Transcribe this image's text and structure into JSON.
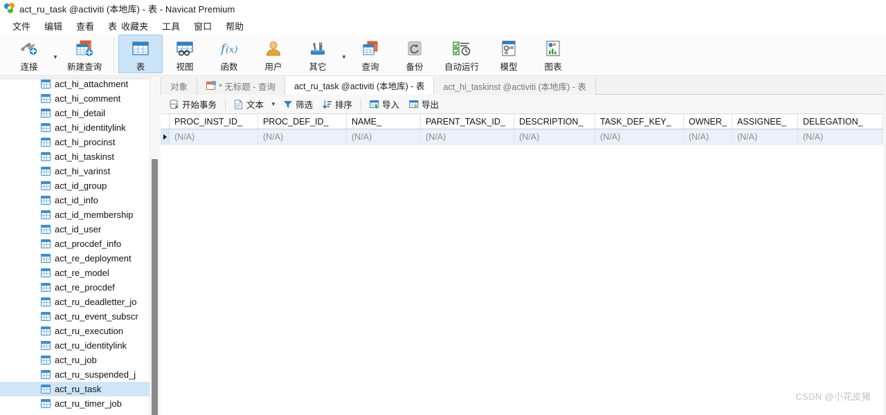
{
  "window": {
    "title": "act_ru_task @activiti (本地库) - 表 - Navicat Premium",
    "app_icon": "navicat-logo-icon"
  },
  "menubar": {
    "items": [
      {
        "label": "文件",
        "name": "menu-file"
      },
      {
        "label": "编辑",
        "name": "menu-edit"
      },
      {
        "label": "查看",
        "name": "menu-view"
      },
      {
        "label": "表",
        "name": "menu-table"
      },
      {
        "label": "收藏夹",
        "name": "menu-favorites"
      },
      {
        "label": "工具",
        "name": "menu-tools"
      },
      {
        "label": "窗口",
        "name": "menu-window"
      },
      {
        "label": "帮助",
        "name": "menu-help"
      }
    ]
  },
  "toolbar": {
    "buttons": [
      {
        "label": "连接",
        "icon": "connection-icon",
        "active": false,
        "has_caret": true
      },
      {
        "label": "新建查询",
        "icon": "new-query-icon",
        "active": false,
        "has_caret": false
      },
      {
        "label": "表",
        "icon": "table-icon",
        "active": true,
        "has_caret": false
      },
      {
        "label": "视图",
        "icon": "view-icon",
        "active": false,
        "has_caret": false
      },
      {
        "label": "函数",
        "icon": "function-icon",
        "active": false,
        "has_caret": false
      },
      {
        "label": "用户",
        "icon": "user-icon",
        "active": false,
        "has_caret": false
      },
      {
        "label": "其它",
        "icon": "other-tools-icon",
        "active": false,
        "has_caret": true
      },
      {
        "label": "查询",
        "icon": "query-icon",
        "active": false,
        "has_caret": false
      },
      {
        "label": "备份",
        "icon": "backup-icon",
        "active": false,
        "has_caret": false
      },
      {
        "label": "自动运行",
        "icon": "automation-icon",
        "active": false,
        "has_caret": false
      },
      {
        "label": "模型",
        "icon": "model-icon",
        "active": false,
        "has_caret": false
      },
      {
        "label": "图表",
        "icon": "chart-icon",
        "active": false,
        "has_caret": false
      }
    ]
  },
  "sidebar": {
    "tables": [
      {
        "label": "act_hi_attachment",
        "selected": false
      },
      {
        "label": "act_hi_comment",
        "selected": false
      },
      {
        "label": "act_hi_detail",
        "selected": false
      },
      {
        "label": "act_hi_identitylink",
        "selected": false
      },
      {
        "label": "act_hi_procinst",
        "selected": false
      },
      {
        "label": "act_hi_taskinst",
        "selected": false
      },
      {
        "label": "act_hi_varinst",
        "selected": false
      },
      {
        "label": "act_id_group",
        "selected": false
      },
      {
        "label": "act_id_info",
        "selected": false
      },
      {
        "label": "act_id_membership",
        "selected": false
      },
      {
        "label": "act_id_user",
        "selected": false
      },
      {
        "label": "act_procdef_info",
        "selected": false
      },
      {
        "label": "act_re_deployment",
        "selected": false
      },
      {
        "label": "act_re_model",
        "selected": false
      },
      {
        "label": "act_re_procdef",
        "selected": false
      },
      {
        "label": "act_ru_deadletter_jo",
        "selected": false
      },
      {
        "label": "act_ru_event_subscr",
        "selected": false
      },
      {
        "label": "act_ru_execution",
        "selected": false
      },
      {
        "label": "act_ru_identitylink",
        "selected": false
      },
      {
        "label": "act_ru_job",
        "selected": false
      },
      {
        "label": "act_ru_suspended_j",
        "selected": false
      },
      {
        "label": "act_ru_task",
        "selected": true
      },
      {
        "label": "act_ru_timer_job",
        "selected": false
      }
    ]
  },
  "tabs": [
    {
      "label": "对象",
      "icon": "none",
      "active": false,
      "name": "tab-objects"
    },
    {
      "label": "* 无标题 - 查询",
      "icon": "query-icon",
      "active": false,
      "name": "tab-untitled-query"
    },
    {
      "label": "act_ru_task @activiti (本地库) - 表",
      "icon": "grid-icon",
      "active": true,
      "name": "tab-act-ru-task"
    },
    {
      "label": "act_hi_taskinst @activiti (本地库) - 表",
      "icon": "grid-icon",
      "active": false,
      "name": "tab-act-hi-taskinst"
    }
  ],
  "gridbar": {
    "buttons": [
      {
        "label": "开始事务",
        "icon": "begin-transaction-icon",
        "caret": false
      },
      {
        "label": "文本",
        "icon": "text-icon",
        "caret": true
      },
      {
        "label": "筛选",
        "icon": "filter-icon",
        "caret": false
      },
      {
        "label": "排序",
        "icon": "sort-icon",
        "caret": false
      },
      {
        "label": "导入",
        "icon": "import-icon",
        "caret": false
      },
      {
        "label": "导出",
        "icon": "export-icon",
        "caret": false
      }
    ]
  },
  "grid": {
    "columns": [
      {
        "label": "PROC_INST_ID_",
        "width": 128
      },
      {
        "label": "PROC_DEF_ID_",
        "width": 128
      },
      {
        "label": "NAME_",
        "width": 107
      },
      {
        "label": "PARENT_TASK_ID_",
        "width": 135
      },
      {
        "label": "DESCRIPTION_",
        "width": 117
      },
      {
        "label": "TASK_DEF_KEY_",
        "width": 128
      },
      {
        "label": "OWNER_",
        "width": 70
      },
      {
        "label": "ASSIGNEE_",
        "width": 95
      },
      {
        "label": "DELEGATION_",
        "width": 122
      }
    ],
    "rows": [
      {
        "selected": true,
        "cells": [
          "(N/A)",
          "(N/A)",
          "(N/A)",
          "(N/A)",
          "(N/A)",
          "(N/A)",
          "(N/A)",
          "(N/A)",
          "(N/A)"
        ]
      }
    ]
  },
  "watermark": {
    "text": "CSDN @小花皮猪"
  },
  "colors": {
    "accent_blue": "#3b8ed0",
    "selection_blue": "#cfe6f7",
    "toolbar_active": "#cce4f7",
    "row_selected": "#e9f1fa",
    "na_text": "#8c8c8c"
  }
}
